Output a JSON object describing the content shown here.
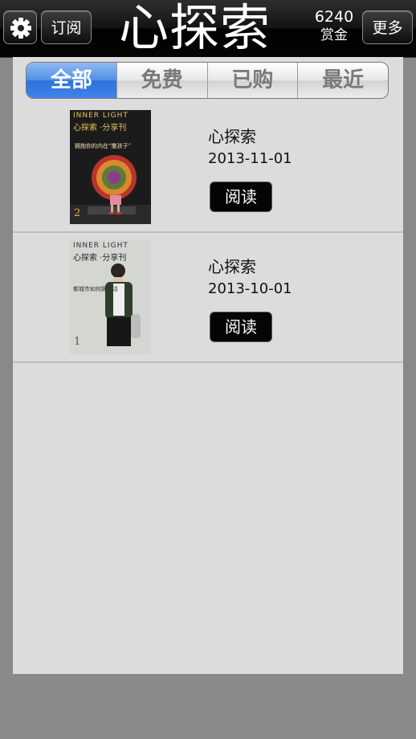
{
  "header": {
    "settings_icon": "gear-icon",
    "subscribe_label": "订阅",
    "logo_text": "心探索",
    "bounty_value": "6240",
    "bounty_label": "赏金",
    "more_label": "更多"
  },
  "tabs": [
    {
      "label": "全部",
      "active": true
    },
    {
      "label": "免费",
      "active": false
    },
    {
      "label": "已购",
      "active": false
    },
    {
      "label": "最近",
      "active": false
    }
  ],
  "issues": [
    {
      "cover": {
        "brand": "INNER LIGHT",
        "name": "心探索 ·分享刊",
        "headline": "拥抱你的内在“撒孩子”",
        "number": "2"
      },
      "title": "心探索",
      "date": "2013-11-01",
      "action": "阅读"
    },
    {
      "cover": {
        "brand": "INNER LIGHT",
        "name": "心探索 ·分享刊",
        "headline": "都城市如何静生活",
        "number": "1"
      },
      "title": "心探索",
      "date": "2013-10-01",
      "action": "阅读"
    }
  ],
  "colors": {
    "accent": "#3f84e8",
    "topbar": "#000000",
    "panel": "#dcdcdc",
    "background": "#898989"
  }
}
